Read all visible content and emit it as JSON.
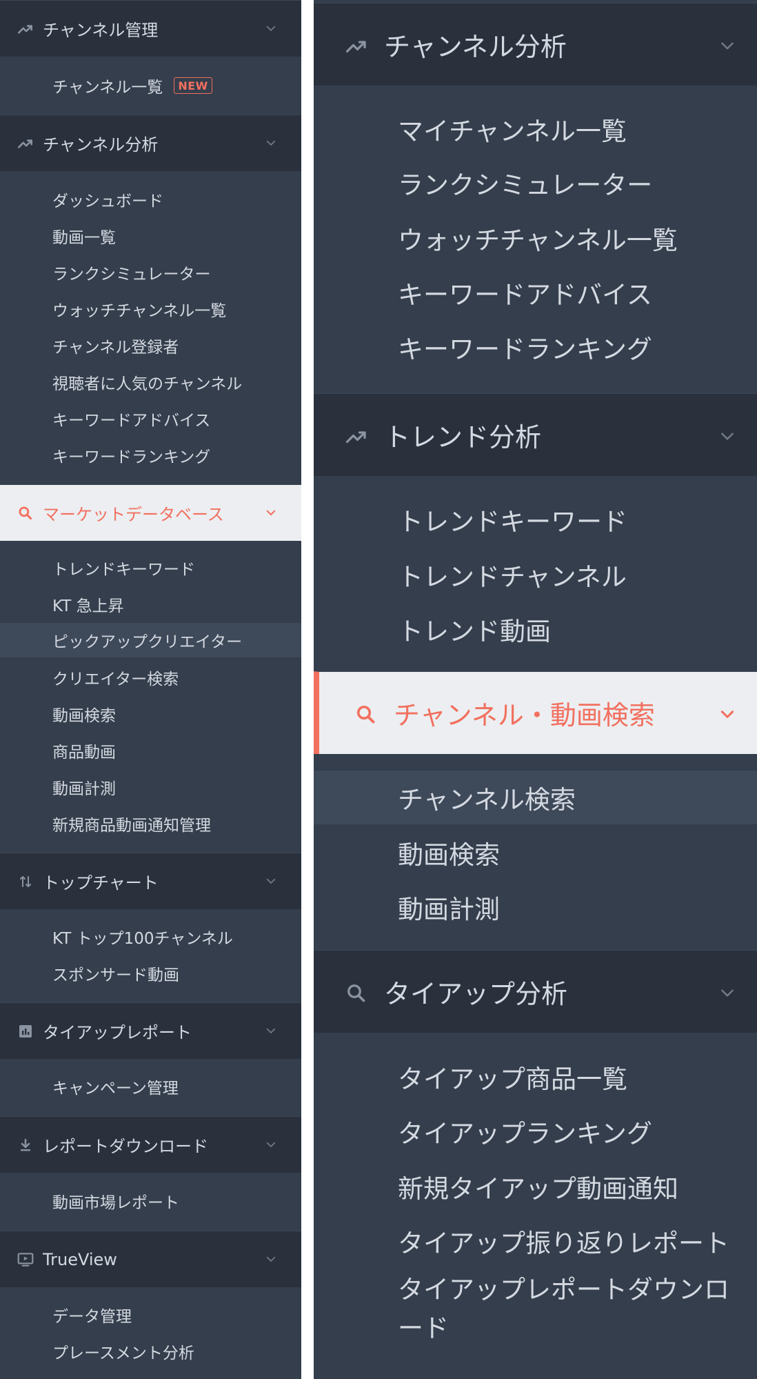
{
  "left": {
    "sections": [
      {
        "title": "チャンネル管理",
        "icon": "trend-icon",
        "items": [
          {
            "label": "チャンネル一覧",
            "badge": "NEW"
          }
        ]
      },
      {
        "title": "チャンネル分析",
        "icon": "trend-icon",
        "items": [
          {
            "label": "ダッシュボード"
          },
          {
            "label": "動画一覧"
          },
          {
            "label": "ランクシミュレーター"
          },
          {
            "label": "ウォッチチャンネル一覧"
          },
          {
            "label": "チャンネル登録者"
          },
          {
            "label": "視聴者に人気のチャンネル"
          },
          {
            "label": "キーワードアドバイス"
          },
          {
            "label": "キーワードランキング"
          }
        ]
      },
      {
        "title": "マーケットデータベース",
        "icon": "search-icon",
        "active": true,
        "items": [
          {
            "label": "トレンドキーワード"
          },
          {
            "label": "KT 急上昇"
          },
          {
            "label": "ピックアップクリエイター",
            "highlighted": true
          },
          {
            "label": "クリエイター検索"
          },
          {
            "label": "動画検索"
          },
          {
            "label": "商品動画"
          },
          {
            "label": "動画計測"
          },
          {
            "label": "新規商品動画通知管理"
          }
        ]
      },
      {
        "title": "トップチャート",
        "icon": "sort-arrows-icon",
        "items": [
          {
            "label": "KT トップ100チャンネル"
          },
          {
            "label": "スポンサード動画"
          }
        ]
      },
      {
        "title": "タイアップレポート",
        "icon": "bar-chart-icon",
        "items": [
          {
            "label": "キャンペーン管理"
          }
        ]
      },
      {
        "title": "レポートダウンロード",
        "icon": "download-icon",
        "items": [
          {
            "label": "動画市場レポート"
          }
        ]
      },
      {
        "title": "TrueView",
        "icon": "play-screen-icon",
        "items": [
          {
            "label": "データ管理"
          },
          {
            "label": "プレースメント分析"
          }
        ]
      }
    ]
  },
  "right": {
    "sections": [
      {
        "title": "チャンネル分析",
        "icon": "trend-icon",
        "items": [
          {
            "label": "マイチャンネル一覧"
          },
          {
            "label": "ランクシミュレーター"
          },
          {
            "label": "ウォッチチャンネル一覧"
          },
          {
            "label": "キーワードアドバイス"
          },
          {
            "label": "キーワードランキング"
          }
        ]
      },
      {
        "title": "トレンド分析",
        "icon": "trend-icon",
        "items": [
          {
            "label": "トレンドキーワード"
          },
          {
            "label": "トレンドチャンネル"
          },
          {
            "label": "トレンド動画"
          }
        ]
      },
      {
        "title": "チャンネル・動画検索",
        "icon": "search-icon",
        "active": true,
        "items": [
          {
            "label": "チャンネル検索",
            "highlighted": true
          },
          {
            "label": "動画検索"
          },
          {
            "label": "動画計測"
          }
        ]
      },
      {
        "title": "タイアップ分析",
        "icon": "search-icon",
        "items": [
          {
            "label": "タイアップ商品一覧"
          },
          {
            "label": "タイアップランキング"
          },
          {
            "label": "新規タイアップ動画通知"
          },
          {
            "label": "タイアップ振り返りレポート"
          },
          {
            "label": "タイアップレポートダウンロード"
          }
        ]
      }
    ]
  },
  "colors": {
    "panel_bg": "#343e4c",
    "header_bg": "#2a313d",
    "active_bg": "#eceef1",
    "accent": "#f2705f",
    "text": "#d4d9e1",
    "highlight_bg": "#3e4959"
  }
}
